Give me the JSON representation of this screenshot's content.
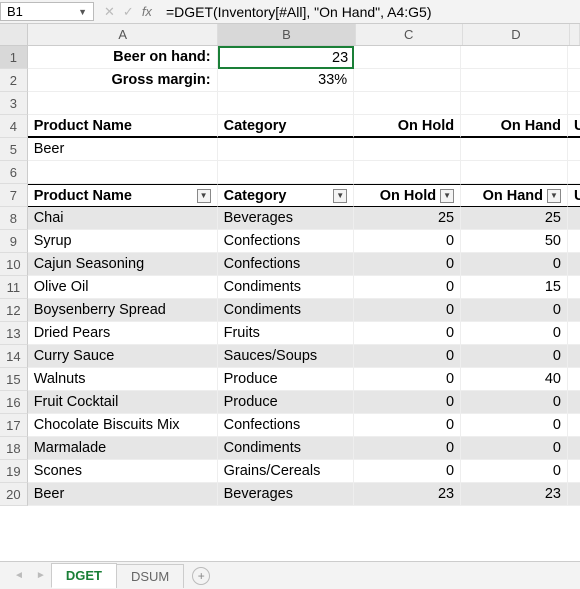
{
  "namebox": "B1",
  "formula": "=DGET(Inventory[#All], \"On Hand\", A4:G5)",
  "cols": {
    "A": "A",
    "B": "B",
    "C": "C",
    "D": "D",
    "E": ""
  },
  "labels": {
    "beer": "Beer on hand:",
    "margin": "Gross margin:"
  },
  "vals": {
    "beer": "23",
    "margin": "33%"
  },
  "hdr": {
    "pname": "Product Name",
    "cat": "Category",
    "onhold": "On Hold",
    "onhand": "On Hand",
    "u": "U"
  },
  "crit": {
    "pname": "Beer"
  },
  "rows": [
    {
      "n": "8",
      "p": "Chai",
      "c": "Beverages",
      "h": "25",
      "o": "25",
      "s": true
    },
    {
      "n": "9",
      "p": "Syrup",
      "c": "Confections",
      "h": "0",
      "o": "50",
      "s": false
    },
    {
      "n": "10",
      "p": "Cajun Seasoning",
      "c": "Confections",
      "h": "0",
      "o": "0",
      "s": true
    },
    {
      "n": "11",
      "p": "Olive Oil",
      "c": "Condiments",
      "h": "0",
      "o": "15",
      "s": false
    },
    {
      "n": "12",
      "p": "Boysenberry Spread",
      "c": "Condiments",
      "h": "0",
      "o": "0",
      "s": true
    },
    {
      "n": "13",
      "p": "Dried Pears",
      "c": "Fruits",
      "h": "0",
      "o": "0",
      "s": false
    },
    {
      "n": "14",
      "p": "Curry Sauce",
      "c": "Sauces/Soups",
      "h": "0",
      "o": "0",
      "s": true
    },
    {
      "n": "15",
      "p": "Walnuts",
      "c": "Produce",
      "h": "0",
      "o": "40",
      "s": false
    },
    {
      "n": "16",
      "p": "Fruit Cocktail",
      "c": "Produce",
      "h": "0",
      "o": "0",
      "s": true
    },
    {
      "n": "17",
      "p": "Chocolate Biscuits Mix",
      "c": "Confections",
      "h": "0",
      "o": "0",
      "s": false
    },
    {
      "n": "18",
      "p": "Marmalade",
      "c": "Condiments",
      "h": "0",
      "o": "0",
      "s": true
    },
    {
      "n": "19",
      "p": "Scones",
      "c": "Grains/Cereals",
      "h": "0",
      "o": "0",
      "s": false
    },
    {
      "n": "20",
      "p": "Beer",
      "c": "Beverages",
      "h": "23",
      "o": "23",
      "s": true
    }
  ],
  "tabs": {
    "dget": "DGET",
    "dsum": "DSUM"
  }
}
